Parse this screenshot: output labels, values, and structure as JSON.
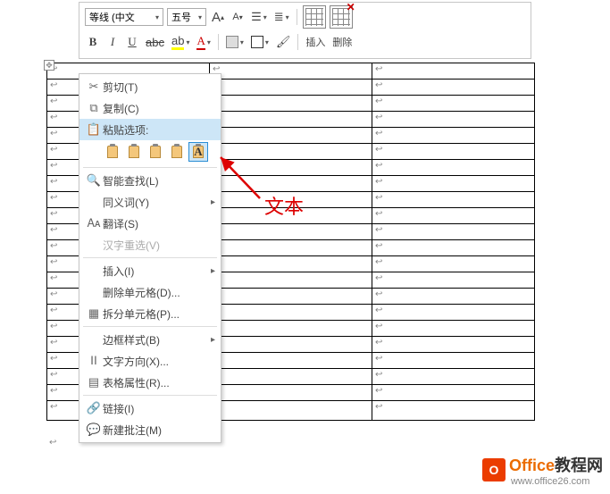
{
  "ribbon": {
    "font_name": "等线 (中文",
    "font_size": "五号",
    "increase_font": "A",
    "decrease_font": "A",
    "insert_label": "插入",
    "delete_label": "删除",
    "bold": "B",
    "italic": "I",
    "underline": "U",
    "font_color": "A"
  },
  "context_menu": {
    "cut": "剪切(T)",
    "copy": "复制(C)",
    "paste_options": "粘贴选项:",
    "paste_text_only": "A",
    "smart_lookup": "智能查找(L)",
    "synonyms": "同义词(Y)",
    "translate": "翻译(S)",
    "chinese_reselect": "汉字重选(V)",
    "insert": "插入(I)",
    "delete_cells": "删除单元格(D)...",
    "split_cells": "拆分单元格(P)...",
    "border_styles": "边框样式(B)",
    "text_direction": "文字方向(X)...",
    "table_properties": "表格属性(R)...",
    "hyperlink": "链接(I)",
    "new_comment": "新建批注(M)"
  },
  "annotation": {
    "text": "文本"
  },
  "watermark": {
    "brand1": "Office",
    "brand2": "教程网",
    "url": "www.office26.com"
  },
  "table": {
    "rows": 22,
    "cols": 3,
    "cell_mark": "↩"
  }
}
